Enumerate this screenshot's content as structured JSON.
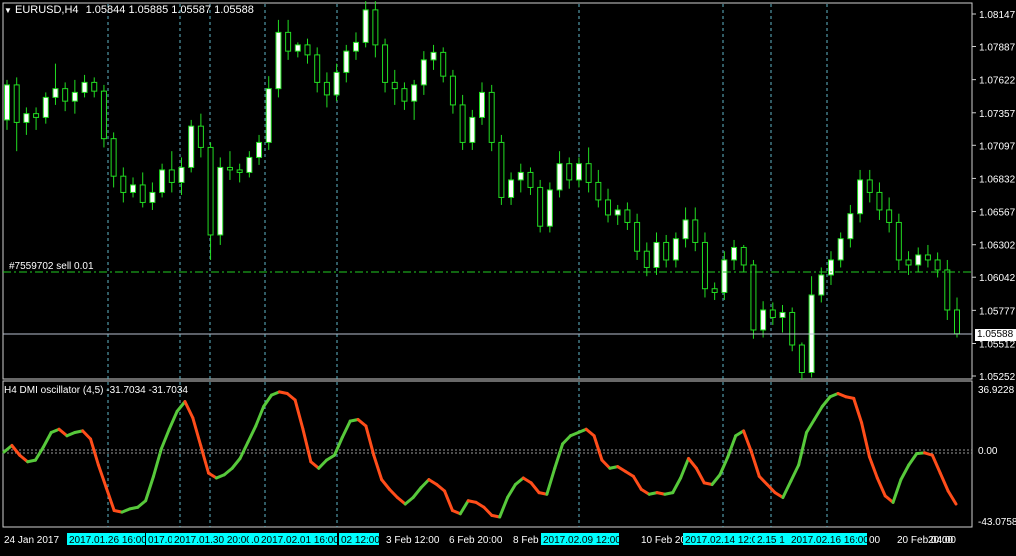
{
  "main_chart": {
    "symbol_label": "EURUSD,H4",
    "ohlc_text": "1.05844 1.05885 1.05587 1.05588",
    "order_label": "#7559702 sell 0.01",
    "current_price": "1.05588",
    "price_ticks": [
      "1.08147",
      "1.07887",
      "1.07622",
      "1.07357",
      "1.07097",
      "1.06832",
      "1.06567",
      "1.06302",
      "1.06042",
      "1.05777",
      "1.05512",
      "1.05252"
    ],
    "candles": [
      [
        1.073,
        1.0762,
        1.0722,
        1.0758
      ],
      [
        1.0758,
        1.0764,
        1.0705,
        1.0728
      ],
      [
        1.0728,
        1.074,
        1.0718,
        1.0735
      ],
      [
        1.0735,
        1.074,
        1.0722,
        1.0732
      ],
      [
        1.0732,
        1.0752,
        1.0727,
        1.0748
      ],
      [
        1.0748,
        1.0775,
        1.0742,
        1.0755
      ],
      [
        1.0755,
        1.076,
        1.0737,
        1.0745
      ],
      [
        1.0745,
        1.0762,
        1.0735,
        1.0752
      ],
      [
        1.0752,
        1.0766,
        1.0748,
        1.076
      ],
      [
        1.076,
        1.0764,
        1.0748,
        1.0753
      ],
      [
        1.0753,
        1.0758,
        1.0708,
        1.0715
      ],
      [
        1.0715,
        1.072,
        1.0676,
        1.0685
      ],
      [
        1.0685,
        1.0692,
        1.0664,
        1.0672
      ],
      [
        1.0672,
        1.0684,
        1.0668,
        1.0678
      ],
      [
        1.0678,
        1.0688,
        1.066,
        1.0664
      ],
      [
        1.0664,
        1.068,
        1.0658,
        1.0672
      ],
      [
        1.0672,
        1.0695,
        1.0668,
        1.069
      ],
      [
        1.069,
        1.0705,
        1.0672,
        1.068
      ],
      [
        1.068,
        1.07,
        1.067,
        1.0692
      ],
      [
        1.0692,
        1.073,
        1.0688,
        1.0725
      ],
      [
        1.0725,
        1.0735,
        1.07,
        1.0708
      ],
      [
        1.0708,
        1.0712,
        1.0618,
        1.0638
      ],
      [
        1.0638,
        1.07,
        1.063,
        1.0692
      ],
      [
        1.0692,
        1.0705,
        1.0682,
        1.069
      ],
      [
        1.069,
        1.0695,
        1.068,
        1.0688
      ],
      [
        1.0688,
        1.0705,
        1.0684,
        1.07
      ],
      [
        1.07,
        1.0718,
        1.0694,
        1.0712
      ],
      [
        1.0712,
        1.0765,
        1.0706,
        1.0755
      ],
      [
        1.0755,
        1.081,
        1.0748,
        1.08
      ],
      [
        1.08,
        1.081,
        1.0778,
        1.0785
      ],
      [
        1.0785,
        1.0792,
        1.078,
        1.079
      ],
      [
        1.079,
        1.0795,
        1.0775,
        1.0782
      ],
      [
        1.0782,
        1.0788,
        1.0752,
        1.076
      ],
      [
        1.076,
        1.0768,
        1.074,
        1.075
      ],
      [
        1.075,
        1.0775,
        1.0745,
        1.0768
      ],
      [
        1.0768,
        1.079,
        1.076,
        1.0785
      ],
      [
        1.0785,
        1.08,
        1.0778,
        1.0792
      ],
      [
        1.0792,
        1.0825,
        1.0788,
        1.0818
      ],
      [
        1.0818,
        1.0825,
        1.078,
        1.079
      ],
      [
        1.079,
        1.0795,
        1.0752,
        1.076
      ],
      [
        1.076,
        1.077,
        1.0742,
        1.0755
      ],
      [
        1.0755,
        1.076,
        1.0738,
        1.0745
      ],
      [
        1.0745,
        1.0762,
        1.073,
        1.0758
      ],
      [
        1.0758,
        1.0785,
        1.075,
        1.0778
      ],
      [
        1.0778,
        1.079,
        1.077,
        1.0784
      ],
      [
        1.0784,
        1.0788,
        1.076,
        1.0765
      ],
      [
        1.0765,
        1.077,
        1.0735,
        1.0742
      ],
      [
        1.0742,
        1.075,
        1.0706,
        1.0712
      ],
      [
        1.0712,
        1.0738,
        1.0706,
        1.0732
      ],
      [
        1.0732,
        1.076,
        1.0726,
        1.0752
      ],
      [
        1.0752,
        1.0758,
        1.0705,
        1.0712
      ],
      [
        1.0712,
        1.0718,
        1.0662,
        1.0668
      ],
      [
        1.0668,
        1.0688,
        1.0662,
        1.0682
      ],
      [
        1.0682,
        1.0695,
        1.0672,
        1.0688
      ],
      [
        1.0688,
        1.0692,
        1.067,
        1.0676
      ],
      [
        1.0676,
        1.0682,
        1.064,
        1.0645
      ],
      [
        1.0645,
        1.068,
        1.064,
        1.0674
      ],
      [
        1.0674,
        1.0705,
        1.0668,
        1.0695
      ],
      [
        1.0695,
        1.07,
        1.0675,
        1.0682
      ],
      [
        1.0682,
        1.07,
        1.0676,
        1.0695
      ],
      [
        1.0695,
        1.0708,
        1.0672,
        1.068
      ],
      [
        1.068,
        1.069,
        1.066,
        1.0666
      ],
      [
        1.0666,
        1.0675,
        1.0648,
        1.0654
      ],
      [
        1.0654,
        1.0662,
        1.0646,
        1.0658
      ],
      [
        1.0658,
        1.0664,
        1.0642,
        1.0648
      ],
      [
        1.0648,
        1.0655,
        1.0618,
        1.0625
      ],
      [
        1.0625,
        1.0632,
        1.0605,
        1.0612
      ],
      [
        1.0612,
        1.064,
        1.0606,
        1.0632
      ],
      [
        1.0632,
        1.0638,
        1.0612,
        1.0618
      ],
      [
        1.0618,
        1.064,
        1.0612,
        1.0635
      ],
      [
        1.0635,
        1.066,
        1.0628,
        1.065
      ],
      [
        1.065,
        1.066,
        1.0625,
        1.0632
      ],
      [
        1.0632,
        1.064,
        1.0588,
        1.0595
      ],
      [
        1.0595,
        1.06,
        1.0586,
        1.0592
      ],
      [
        1.0592,
        1.0625,
        1.0586,
        1.0618
      ],
      [
        1.0618,
        1.0634,
        1.061,
        1.0628
      ],
      [
        1.0628,
        1.063,
        1.0608,
        1.0614
      ],
      [
        1.0614,
        1.0618,
        1.0555,
        1.0562
      ],
      [
        1.0562,
        1.0585,
        1.0556,
        1.0578
      ],
      [
        1.0578,
        1.0584,
        1.0566,
        1.0572
      ],
      [
        1.0572,
        1.0582,
        1.056,
        1.0576
      ],
      [
        1.0576,
        1.058,
        1.0545,
        1.055
      ],
      [
        1.055,
        1.0552,
        1.0522,
        1.0528
      ],
      [
        1.0528,
        1.0605,
        1.0524,
        1.059
      ],
      [
        1.059,
        1.0612,
        1.0584,
        1.0606
      ],
      [
        1.0606,
        1.0625,
        1.0598,
        1.0618
      ],
      [
        1.0618,
        1.064,
        1.0612,
        1.0635
      ],
      [
        1.0635,
        1.0662,
        1.0628,
        1.0655
      ],
      [
        1.0655,
        1.069,
        1.0648,
        1.0682
      ],
      [
        1.0682,
        1.069,
        1.0664,
        1.0672
      ],
      [
        1.0672,
        1.068,
        1.065,
        1.0658
      ],
      [
        1.0658,
        1.0668,
        1.064,
        1.0648
      ],
      [
        1.0648,
        1.0655,
        1.061,
        1.0618
      ],
      [
        1.0618,
        1.0625,
        1.0606,
        1.0614
      ],
      [
        1.0614,
        1.0628,
        1.0608,
        1.0622
      ],
      [
        1.0622,
        1.063,
        1.0612,
        1.0618
      ],
      [
        1.0618,
        1.0624,
        1.0604,
        1.061
      ],
      [
        1.061,
        1.0618,
        1.057,
        1.0578
      ],
      [
        1.0578,
        1.0588,
        1.0556,
        1.0559
      ]
    ]
  },
  "indicator": {
    "label": "H4 DMI oscillator (4,5) -31.7034 -31.7034",
    "max_label": "36.9228",
    "zero_label": "0.00",
    "min_label": "-43.0758",
    "ylim": [
      -43.0758,
      36.9228
    ],
    "values": [
      0,
      4,
      -2,
      -6,
      -5,
      3,
      12,
      14,
      10,
      12,
      13,
      8,
      -8,
      -22,
      -36,
      -37,
      -35,
      -34,
      -30,
      -15,
      2,
      14,
      25,
      31,
      21,
      4,
      -13,
      -16,
      -14,
      -10,
      -4,
      6,
      16,
      28,
      35,
      37,
      36,
      32,
      14,
      -6,
      -10,
      -5,
      -2,
      9,
      19,
      20,
      16,
      -2,
      -17,
      -23,
      -28,
      -32,
      -28,
      -22,
      -17,
      -20,
      -24,
      -36,
      -38,
      -30,
      -31,
      -34,
      -39,
      -40,
      -28,
      -20,
      -16,
      -19,
      -25,
      -26,
      -10,
      5,
      10,
      12,
      14,
      10,
      -5,
      -10,
      -9,
      -12,
      -15,
      -23,
      -26,
      -25,
      -26,
      -25,
      -16,
      -4,
      -10,
      -19,
      -20,
      -14,
      -3,
      10,
      13,
      0,
      -15,
      -20,
      -25,
      -28,
      -18,
      -8,
      12,
      20,
      28,
      34,
      36,
      34,
      33,
      18,
      -3,
      -16,
      -27,
      -31,
      -17,
      -8,
      -1,
      -0.5,
      -2,
      -13,
      -24,
      -32
    ]
  },
  "time_axis": {
    "plain_labels": [
      "24 Jan 2017",
      "3 Feb 12:00",
      "6 Feb 20:00",
      "8 Feb",
      "10 Feb 20",
      "20 Feb 04:00"
    ],
    "highlight_labels": [
      "2017.01.26 16:00",
      "017.0",
      "2017.01.30 20:00",
      ".0",
      "2017.02.01 16:00",
      "02 12:00",
      "2017.02.09 12:00",
      "2017.02.14 12:00",
      "2.15 1",
      "2017.02.16 16:00"
    ],
    "tail_labels": [
      "00",
      "20:00"
    ]
  },
  "colors": {
    "background": "#000000",
    "grid_vline": "#5fb6c9",
    "candle_up": "#ffffff",
    "candle_down": "#000000",
    "candle_wick": "#22dd22",
    "order_line": "#22cc22",
    "price_line": "#b9c1cf",
    "osc_up": "#57c93b",
    "osc_down": "#ff4d1a",
    "highlight_bg": "#00ffff"
  }
}
